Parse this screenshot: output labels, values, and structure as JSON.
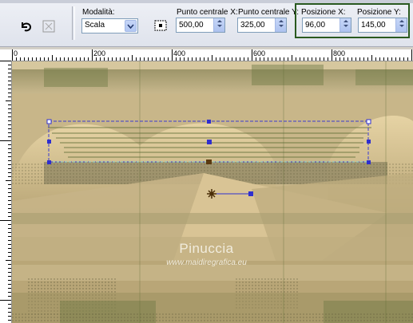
{
  "toolbar": {
    "modalita_label": "Modalità:",
    "modalita_value": "Scala",
    "punto_x_label": "Punto centrale X:",
    "punto_x_value": "500,00",
    "punto_y_label": "Punto centrale Y:",
    "punto_y_value": "325,00",
    "pos_x_label": "Posizione X:",
    "pos_x_value": "96,00",
    "pos_y_label": "Posizione Y:",
    "pos_y_value": "145,00",
    "highlight_color": "#2a5a20",
    "tool_icons": [
      "undo-arrow-icon",
      "pick-tool-icon",
      "center-icon"
    ]
  },
  "rulers": {
    "top_labels": [
      "0",
      "200",
      "400",
      "600",
      "800"
    ]
  },
  "watermark": {
    "name": "Pinuccia",
    "site": "www.maidiregrafica.eu"
  },
  "colors": {
    "canvas_tan": "#c9b68a",
    "canvas_green": "#6f7a46",
    "selection": "#3c3cd0"
  }
}
